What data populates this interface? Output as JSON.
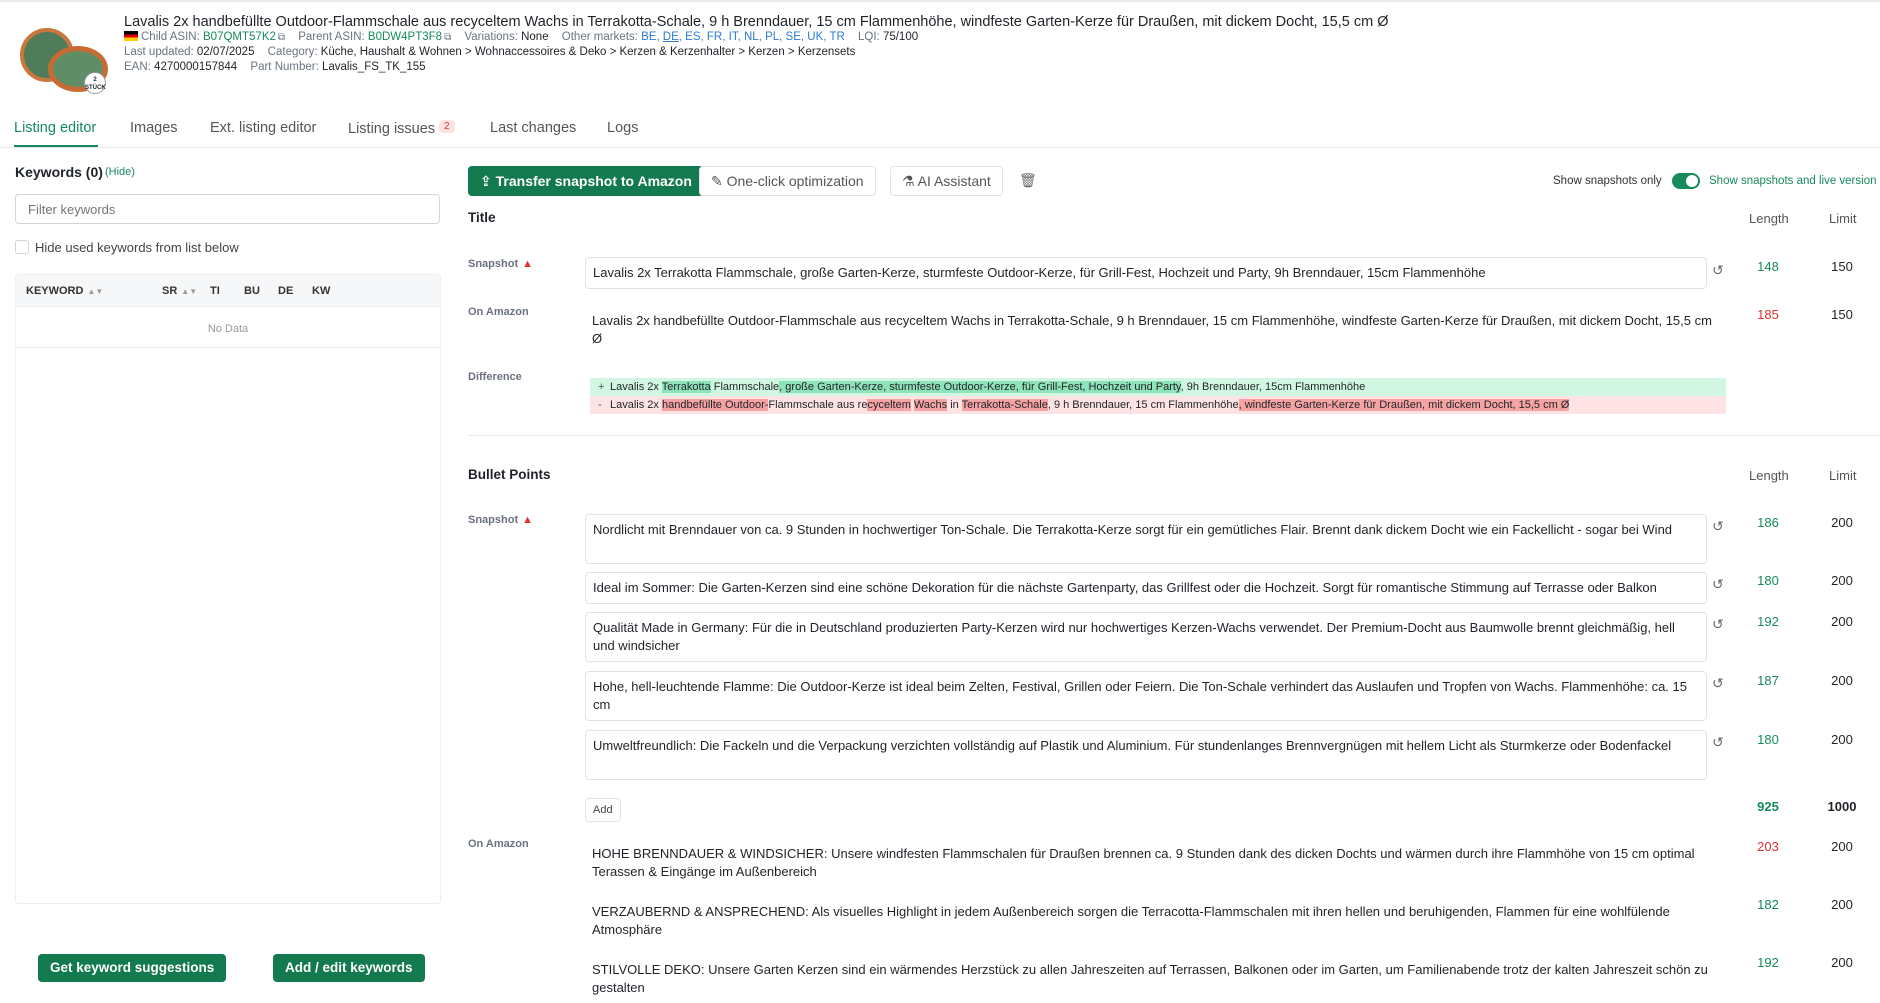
{
  "product": {
    "title": "Lavalis 2x handbefüllte Outdoor-Flammschale aus recyceltem Wachs in Terrakotta-Schale, 9 h Brenndauer, 15 cm Flammenhöhe, windfeste Garten-Kerze für Draußen, mit dickem Docht, 15,5 cm Ø",
    "thumbnail_badge": "2 STÜCK",
    "child_asin_label": "Child ASIN:",
    "child_asin": "B07QMT57K2",
    "parent_asin_label": "Parent ASIN:",
    "parent_asin": "B0DW4PT3F8",
    "variations_label": "Variations:",
    "variations": "None",
    "other_markets_label": "Other markets:",
    "other_markets": [
      "BE",
      "DE",
      "ES",
      "FR",
      "IT",
      "NL",
      "PL",
      "SE",
      "UK",
      "TR"
    ],
    "lqi_label": "LQI:",
    "lqi": "75/100",
    "last_updated_label": "Last updated:",
    "last_updated": "02/07/2025",
    "category_label": "Category:",
    "category": "Küche, Haushalt & Wohnen > Wohnaccessoires & Deko > Kerzen & Kerzenhalter > Kerzen > Kerzensets",
    "ean_label": "EAN:",
    "ean": "4270000157844",
    "part_number_label": "Part Number:",
    "part_number": "Lavalis_FS_TK_155"
  },
  "tabs": [
    {
      "label": "Listing editor"
    },
    {
      "label": "Images"
    },
    {
      "label": "Ext. listing editor"
    },
    {
      "label": "Listing issues",
      "badge": "2"
    },
    {
      "label": "Last changes"
    },
    {
      "label": "Logs"
    }
  ],
  "keywords": {
    "heading": "Keywords (0)",
    "hide": "(Hide)",
    "filter_placeholder": "Filter keywords",
    "hide_used": "Hide used keywords from list below",
    "columns": [
      "KEYWORD",
      "SR",
      "TI",
      "BU",
      "DE",
      "KW"
    ],
    "empty": "No Data",
    "suggest_button": "Get keyword suggestions",
    "edit_button": "Add / edit keywords"
  },
  "toolbar": {
    "transfer": "Transfer snapshot to Amazon",
    "optimize": "One-click optimization",
    "ai": "AI Assistant",
    "show_snapshots_only": "Show snapshots only",
    "show_snapshots_live": "Show snapshots and live version"
  },
  "title_section": {
    "heading": "Title",
    "length_col": "Length",
    "limit_col": "Limit",
    "snapshot_label": "Snapshot",
    "snapshot": "Lavalis 2x Terrakotta Flammschale, große Garten-Kerze, sturmfeste Outdoor-Kerze, für Grill-Fest, Hochzeit und Party, 9h Brenndauer, 15cm Flammenhöhe",
    "snapshot_length": "148",
    "snapshot_limit": "150",
    "amazon_label": "On Amazon",
    "amazon": "Lavalis 2x handbefüllte Outdoor-Flammschale aus recyceltem Wachs in Terrakotta-Schale, 9 h Brenndauer, 15 cm Flammenhöhe, windfeste Garten-Kerze für Draußen, mit dickem Docht, 15,5 cm Ø",
    "amazon_length": "185",
    "amazon_limit": "150",
    "difference_label": "Difference",
    "diff_add_sign": "+",
    "diff_del_sign": "-"
  },
  "bullets_section": {
    "heading": "Bullet Points",
    "length_col": "Length",
    "limit_col": "Limit",
    "snapshot_label": "Snapshot",
    "snapshot": [
      {
        "text": "Nordlicht mit Brenndauer von ca. 9 Stunden in hochwertiger Ton-Schale. Die Terrakotta-Kerze sorgt für ein gemütliches Flair. Brennt dank dickem Docht wie ein Fackellicht - sogar bei Wind",
        "length": "186",
        "limit": "200"
      },
      {
        "text": "Ideal im Sommer: Die Garten-Kerzen sind eine schöne Dekoration für die nächste Gartenparty, das Grillfest oder die Hochzeit. Sorgt für romantische Stimmung auf Terrasse oder Balkon",
        "length": "180",
        "limit": "200"
      },
      {
        "text": "Qualität Made in Germany: Für die in Deutschland produzierten Party-Kerzen wird nur hochwertiges Kerzen-Wachs verwendet. Der Premium-Docht aus Baumwolle brennt gleichmäßig, hell und windsicher",
        "length": "192",
        "limit": "200"
      },
      {
        "text": "Hohe, hell-leuchtende Flamme: Die Outdoor-Kerze ist ideal beim Zelten, Festival, Grillen oder Feiern. Die Ton-Schale verhindert das Auslaufen und Tropfen von Wachs. Flammenhöhe: ca. 15 cm",
        "length": "187",
        "limit": "200"
      },
      {
        "text": "Umweltfreundlich: Die Fackeln und die Verpackung verzichten vollständig auf Plastik und Aluminium. Für stundenlanges Brennvergnügen mit hellem Licht als Sturmkerze oder Bodenfackel",
        "length": "180",
        "limit": "200"
      }
    ],
    "add": "Add",
    "total_length": "925",
    "total_limit": "1000",
    "amazon_label": "On Amazon",
    "amazon": [
      {
        "text": "HOHE BRENNDAUER & WINDSICHER: Unsere windfesten Flammschalen für Draußen brennen ca. 9 Stunden dank des dicken Dochts und wärmen durch ihre Flammhöhe von 15 cm optimal Terassen & Eingänge im Außenbereich",
        "length": "203",
        "limit": "200"
      },
      {
        "text": "VERZAUBERND & ANSPRECHEND: Als visuelles Highlight in jedem Außenbereich sorgen die Terracotta-Flammschalen mit ihren hellen und beruhigenden, Flammen für eine wohlfülende Atmosphäre",
        "length": "182",
        "limit": "200"
      },
      {
        "text": "STILVOLLE DEKO: Unsere Garten Kerzen sind ein wärmendes Herzstück zu allen Jahreszeiten auf Terrassen, Balkonen oder im Garten, um Familienabende trotz der kalten Jahreszeit schön zu gestalten",
        "length": "192",
        "limit": "200"
      }
    ]
  },
  "colors": {
    "accent": "#168a5c",
    "button": "#13794f",
    "danger": "#e03131",
    "diff_add": "#d1f7e2",
    "diff_del": "#fde3e3"
  }
}
